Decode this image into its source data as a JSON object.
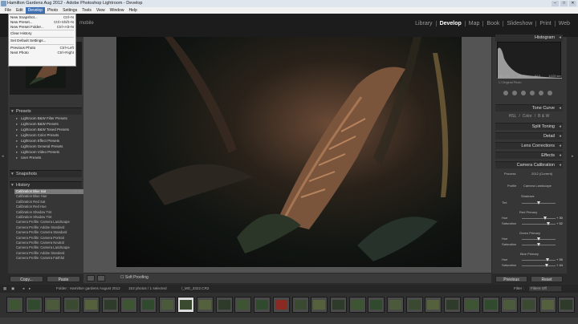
{
  "window": {
    "title": "Hamilton Gardens Aug 2012 - Adobe Photoshop Lightroom - Develop"
  },
  "menubar": {
    "items": [
      "File",
      "Edit",
      "Develop",
      "Photo",
      "Settings",
      "Tools",
      "View",
      "Window",
      "Help"
    ],
    "active": "Develop"
  },
  "develop_menu": {
    "items": [
      {
        "label": "New Snapshot...",
        "shortcut": "Ctrl+N"
      },
      {
        "label": "New Preset...",
        "shortcut": "Ctrl+Shift+N"
      },
      {
        "label": "New Preset Folder...",
        "shortcut": "Ctrl+Alt+N"
      },
      {
        "label": "Clear History",
        "shortcut": ""
      },
      {
        "label": "Set Default Settings...",
        "shortcut": ""
      },
      {
        "label": "Previous Photo",
        "shortcut": "Ctrl+Left"
      },
      {
        "label": "Next Photo",
        "shortcut": "Ctrl+Right"
      }
    ]
  },
  "identity_plate": "mobile",
  "modules": [
    "Library",
    "Develop",
    "Map",
    "Book",
    "Slideshow",
    "Print",
    "Web"
  ],
  "active_module": "Develop",
  "left_panel": {
    "presets_header": "Presets",
    "presets": [
      "Lightroom B&W Filter Presets",
      "Lightroom B&W Presets",
      "Lightroom B&W Toned Presets",
      "Lightroom Color Presets",
      "Lightroom Effect Presets",
      "Lightroom General Presets",
      "Lightroom Video Presets",
      "User Presets"
    ],
    "snapshots_header": "Snapshots",
    "history_header": "History",
    "history": [
      {
        "label": "Calibration Blue Sat",
        "a": "+44",
        "b": "54"
      },
      {
        "label": "Calibration Blue Hue",
        "a": "",
        "b": ""
      },
      {
        "label": "Calibration Red Sat",
        "a": "",
        "b": ""
      },
      {
        "label": "Calibration Red Hue",
        "a": "",
        "b": ""
      },
      {
        "label": "Calibration Shadow Tint",
        "a": "",
        "b": ""
      },
      {
        "label": "Calibration Shadow Tint",
        "a": "",
        "b": ""
      },
      {
        "label": "Camera Profile: Camera Landscape",
        "a": "",
        "b": ""
      },
      {
        "label": "Camera Profile: Adobe Standard",
        "a": "",
        "b": ""
      },
      {
        "label": "Camera Profile: Camera Standard",
        "a": "",
        "b": ""
      },
      {
        "label": "Camera Profile: Camera Portrait",
        "a": "",
        "b": ""
      },
      {
        "label": "Camera Profile: Camera Neutral",
        "a": "",
        "b": ""
      },
      {
        "label": "Camera Profile: Camera Landscape",
        "a": "",
        "b": ""
      },
      {
        "label": "Camera Profile: Adobe Standard",
        "a": "",
        "b": ""
      },
      {
        "label": "Camera Profile: Camera Faithful",
        "a": "",
        "b": ""
      }
    ],
    "copy_button": "Copy...",
    "paste_button": "Paste"
  },
  "toolbar": {
    "soft_proofing": "Soft Proofing"
  },
  "right_panel": {
    "histogram_header": "Histogram",
    "hist_info": [
      "ISO 100",
      "18 mm",
      "f/4.5",
      "1/125 sec"
    ],
    "original_photo": "Original Photo",
    "panels": [
      "Tone Curve",
      "Split Toning",
      "Detail",
      "Lens Corrections",
      "Effects",
      "Camera Calibration"
    ],
    "hsl_tabs": [
      "HSL",
      "/",
      "Color",
      "/",
      "B & W"
    ],
    "calibration": {
      "process_label": "Process",
      "process_value": "2012 (Current)",
      "profile_label": "Profile",
      "profile_value": "Camera Landscape",
      "shadows": "Shadows",
      "tint": "Tint",
      "red_primary": "Red Primary",
      "green_primary": "Green Primary",
      "blue_primary": "Blue Primary",
      "hue": "Hue",
      "saturation": "Saturation",
      "values": {
        "red_hue": "+ 30",
        "red_sat": "+ 52",
        "blue_hue": "+ 55",
        "blue_sat": "+ 44"
      }
    },
    "previous_button": "Previous",
    "reset_button": "Reset"
  },
  "filmstrip_bar": {
    "folder": "Folder : Hamilton gardens August 2012",
    "count": "153 photos / 1 selected",
    "filename": "/_MG_3322.CR2",
    "filter_label": "Filter :",
    "filter_value": "Filters Off"
  },
  "colors": {
    "accent": "#3d6fb3",
    "panel": "#363636",
    "background": "#2a2a2a"
  }
}
